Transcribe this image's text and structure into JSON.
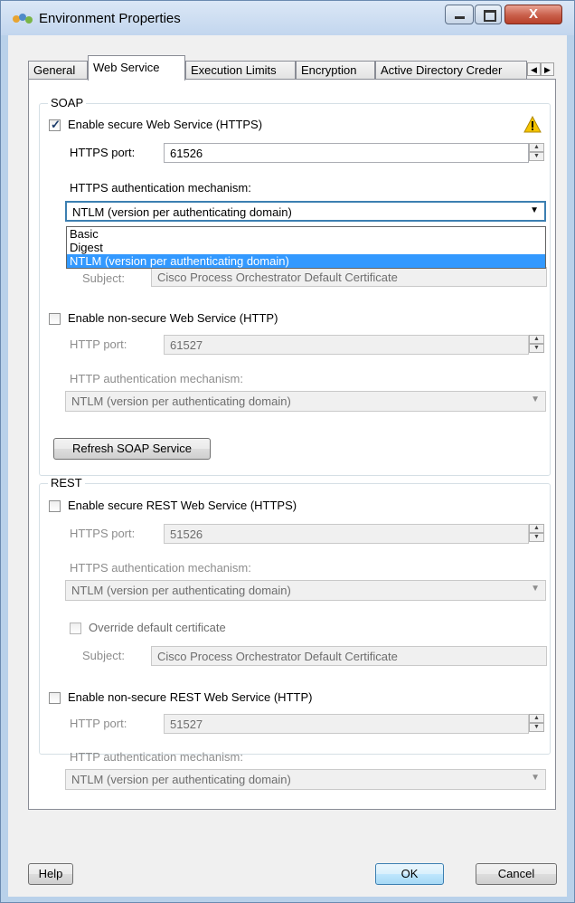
{
  "window": {
    "title": "Environment Properties",
    "close_glyph": "X"
  },
  "tabs": [
    "General",
    "Web Service",
    "Execution Limits",
    "Encryption",
    "Active Directory Creder"
  ],
  "active_tab": "Web Service",
  "soap": {
    "group_label": "SOAP",
    "https_enable_label": "Enable secure Web Service (HTTPS)",
    "https_enabled": true,
    "https_port_label": "HTTPS port:",
    "https_port_value": "61526",
    "https_auth_label": "HTTPS authentication mechanism:",
    "https_auth_value": "NTLM (version per authenticating domain)",
    "dropdown_options": [
      "Basic",
      "Digest",
      "NTLM (version per authenticating domain)"
    ],
    "dropdown_selected_index": 2,
    "obscured_subject_label": "Subject:",
    "obscured_subject_value": "Cisco Process Orchestrator Default Certificate",
    "http_enable_label": "Enable non-secure Web Service (HTTP)",
    "http_enabled": false,
    "http_port_label": "HTTP port:",
    "http_port_value": "61527",
    "http_auth_label": "HTTP authentication mechanism:",
    "http_auth_value": "NTLM (version per authenticating domain)",
    "refresh_label": "Refresh SOAP Service"
  },
  "rest": {
    "group_label": "REST",
    "https_enable_label": "Enable secure REST Web Service (HTTPS)",
    "https_port_label": "HTTPS port:",
    "https_port_value": "51526",
    "https_auth_label": "HTTPS authentication mechanism:",
    "https_auth_value": "NTLM (version per authenticating domain)",
    "override_label": "Override default certificate",
    "subject_label": "Subject:",
    "subject_value": "Cisco Process Orchestrator Default Certificate",
    "http_enable_label": "Enable non-secure REST Web Service (HTTP)",
    "http_port_label": "HTTP port:",
    "http_port_value": "51527",
    "http_auth_label": "HTTP authentication mechanism:",
    "http_auth_value": "NTLM (version per authenticating domain)"
  },
  "footer": {
    "help": "Help",
    "ok": "OK",
    "cancel": "Cancel"
  },
  "colors": {
    "selection": "#3399ff",
    "warning": "#f5c400",
    "title_bg": "#c2d6ee"
  }
}
